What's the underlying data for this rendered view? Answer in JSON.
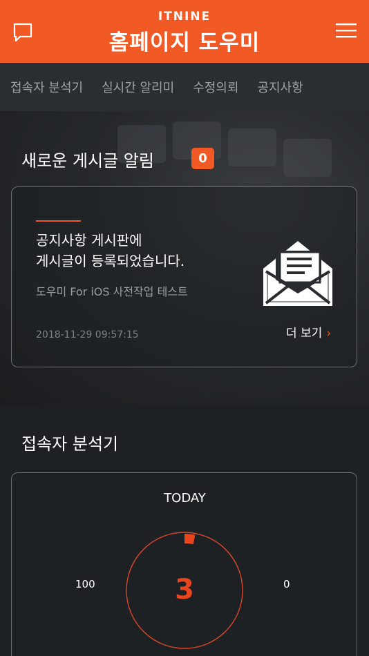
{
  "header": {
    "brand_small": "ITNINE",
    "title": "홈페이지 도우미",
    "left_icon": "chat-icon",
    "right_icon": "hamburger-menu-icon",
    "accent_color": "#f15a24"
  },
  "nav": {
    "items": [
      {
        "label": "접속자 분석기"
      },
      {
        "label": "실시간 알리미"
      },
      {
        "label": "수정의뢰"
      },
      {
        "label": "공지사항"
      }
    ]
  },
  "notifications": {
    "title": "새로운 게시글 알림",
    "badge_count": "0",
    "card": {
      "message_line1": "공지사항 게시판에",
      "message_line2": "게시글이 등록되었습니다.",
      "subtitle": "도우미 For iOS 사전작업 테스트",
      "timestamp": "2018-11-29 09:57:15",
      "more_label": "더 보기",
      "more_arrow": "›",
      "icon": "open-envelope-icon"
    }
  },
  "stats": {
    "title": "접속자 분석기",
    "period_label": "TODAY",
    "left_value": "100",
    "right_value": "0",
    "today_count": "3",
    "gauge_fraction": 0.03
  }
}
